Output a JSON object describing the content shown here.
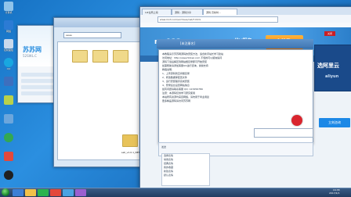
{
  "desktop": {
    "icons": [
      {
        "label": "计算机",
        "color": "#8fc3ea"
      },
      {
        "label": "网络",
        "color": "#2c7bd4"
      },
      {
        "label": "控制面板",
        "color": "#c9d9ec"
      },
      {
        "label": "QQ",
        "color": "#19a7e0"
      },
      {
        "label": "",
        "color": "#3d6fbe"
      },
      {
        "label": "",
        "color": "#b8d14b"
      },
      {
        "label": "",
        "color": "#6ca6dc"
      },
      {
        "label": "",
        "color": "#33a852"
      },
      {
        "label": "",
        "color": "#e3483b"
      },
      {
        "label": "",
        "color": "#202020"
      }
    ]
  },
  "qq_window": {
    "title": "苏苏网",
    "subtitle": "52SWL.C"
  },
  "file_manager": {
    "address": "sssss",
    "zip_name": "sell_v1.0.1_NET.zip"
  },
  "browser": {
    "tabs": [
      {
        "label": "C#全局上海"
      },
      {
        "label": "源码 - 源码分享"
      },
      {
        "label": "源码 高校时..."
      }
    ],
    "url": "www.mx3.com/archives/net/7.html",
    "site_logo": "mx123",
    "site_yougou": "优V服务",
    "site_vip": "VIP",
    "promo_title": "选阿里云",
    "promo_sub": "aliyun",
    "promo_button": "立刻咨询"
  },
  "chat": {
    "header_title": "[未注册名]",
    "lines": [
      "本教程演示苏苏网源码的安装方法，适合新手站长学习建站",
      "访问地址：http://www.52swl.com 不懂的可以留言提问",
      "源码下载后解压到网站根目录即可开始安装",
      "如需帮助请添加客服QQ进行咨询，谢谢支持",
      "",
      "教程说明：",
      "  1、上传源码到空间根目录",
      "  2、修改数据库配置文件",
      "  3、运行安装程序完成安装",
      "  4、登录后台设置网站信息",
      "",
      "如有问题请联系客服  QQ: 123456789",
      "注意：本源码仅供学习研究使用",
      "本站所有资源均来自网络，请勿用于商业用途",
      "更多精品源码请访问苏苏网"
    ],
    "input_placeholder": "发送",
    "emoji_items": [
      "选择表情",
      "常用表情",
      "经典表情",
      "我的收藏",
      "新建表情",
      "默认表情"
    ],
    "red_tag": "关闭"
  },
  "taskbar": {
    "clock_time": "16:38",
    "clock_date": "2017/4/1",
    "items": [
      {
        "color": "#3d7fd6"
      },
      {
        "color": "#f2c14a"
      },
      {
        "color": "#2bb34e"
      },
      {
        "color": "#e3483b"
      },
      {
        "color": "#4aa3e3"
      },
      {
        "color": "#9a5fd0"
      }
    ]
  }
}
